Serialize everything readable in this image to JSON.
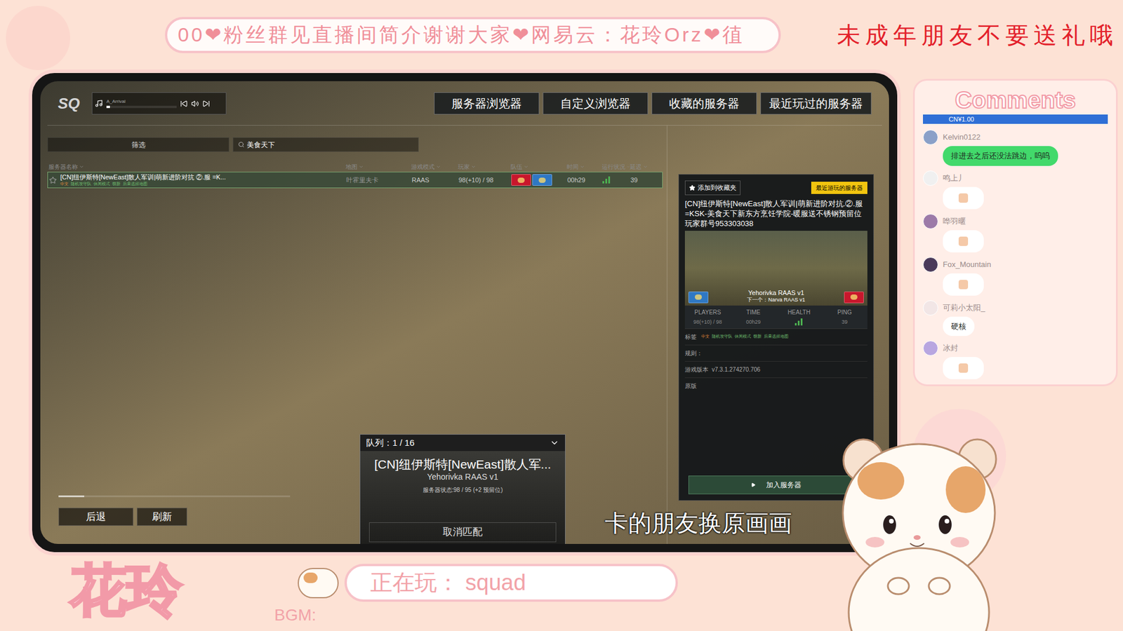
{
  "banner": {
    "text": "00❤粉丝群见直播间简介谢谢大家❤网易云：花玲Orz❤徝",
    "notice": "未成年朋友不要送礼哦"
  },
  "game": {
    "logo": "SQ",
    "music": {
      "track": "A_Arrival",
      "level": 0.03
    },
    "tabs": [
      {
        "label": "服务器浏览器",
        "selected": false
      },
      {
        "label": "自定义浏览器",
        "selected": false
      },
      {
        "label": "收藏的服务器",
        "selected": false
      },
      {
        "label": "最近玩过的服务器",
        "selected": false
      }
    ],
    "filter": {
      "label": "筛选",
      "search": "美食天下"
    },
    "columns": [
      "服务器名称",
      "地图",
      "游戏模式",
      "玩家",
      "队伍",
      "时间",
      "运行状况",
      "延迟"
    ],
    "servers": [
      {
        "name": "[CN]纽伊斯特[NewEast]散人军训|萌新进阶对抗 ②.服 =K...",
        "map": "叶霍里夫卡",
        "mode": "RAAS",
        "players": "98(+10) / 98",
        "time": "00h29",
        "health": 1,
        "ping": "39",
        "selected": true,
        "favorite": false
      }
    ],
    "tags": [
      {
        "text": "中文",
        "color": "#e0883a"
      },
      {
        "text": "随机攻守队",
        "color": "#6fbf6f"
      },
      {
        "text": "休闲模式",
        "color": "#6fbf6f"
      },
      {
        "text": "萌新",
        "color": "#6fbf6f"
      },
      {
        "text": "后果选择地图",
        "color": "#6fbf6f"
      }
    ],
    "teams": [
      {
        "color": "#c8172c"
      },
      {
        "color": "#2f78c4"
      }
    ],
    "detail": {
      "favorite": "添加到收藏夹",
      "recent": "最近游玩的服务器",
      "title": "[CN]纽伊斯特[NewEast]散人军训|萌新进阶对抗.②.服 =KSK-美食天下新东方烹饪学院-暖服送不锈钢预留位 玩家群号953303038",
      "map": "Yehorivka RAAS v1",
      "next": "下一个：Narva RAAS v1",
      "stats": [
        {
          "label": "PLAYERS",
          "kind": "text",
          "value": "98(+10) / 98"
        },
        {
          "label": "TIME",
          "kind": "text",
          "value": "00h29"
        },
        {
          "label": "HEALTH",
          "kind": "bars",
          "level": 1
        },
        {
          "label": "PING",
          "kind": "text",
          "value": "39"
        }
      ],
      "tags_label": "标签",
      "rules_label": "规则：",
      "version_label": "游戏版本",
      "version": "v7.3.1.274270.706",
      "edition": "原版",
      "join": "加入服务器"
    },
    "queue": {
      "title": "队列：1 / 16",
      "server": "[CN]纽伊斯特[NewEast]散人军...",
      "map": "Yehorivka RAAS v1",
      "status": "服务器状态:98 / 95 (+2 预留位)",
      "cancel": "取消匹配"
    },
    "nav": {
      "back": "后退",
      "refresh": "刷新",
      "level": 0.11
    },
    "subtitle": "卡的朋友换原画画"
  },
  "comments": {
    "title": "Comments",
    "gift": "CN¥1.00",
    "items": [
      {
        "user": "Kelvin0122",
        "kind": "text",
        "text": "排进去之后还没法跳边，呜呜",
        "color": "#42d96b"
      },
      {
        "user": "鸣上丿",
        "kind": "sticker",
        "color": "#ffffff"
      },
      {
        "user": "哗羽暱",
        "kind": "sticker",
        "color": "#ffffff"
      },
      {
        "user": "Fox_Mountain",
        "kind": "sticker",
        "color": "#ffffff"
      },
      {
        "user": "可莉小太阳_",
        "kind": "text",
        "text": "硬核",
        "color": "#ffffff"
      },
      {
        "user": "冰封",
        "kind": "sticker",
        "color": "#ffffff"
      }
    ]
  },
  "now_playing": "正在玩： squad",
  "bgm": "BGM:",
  "logo": "花玲"
}
